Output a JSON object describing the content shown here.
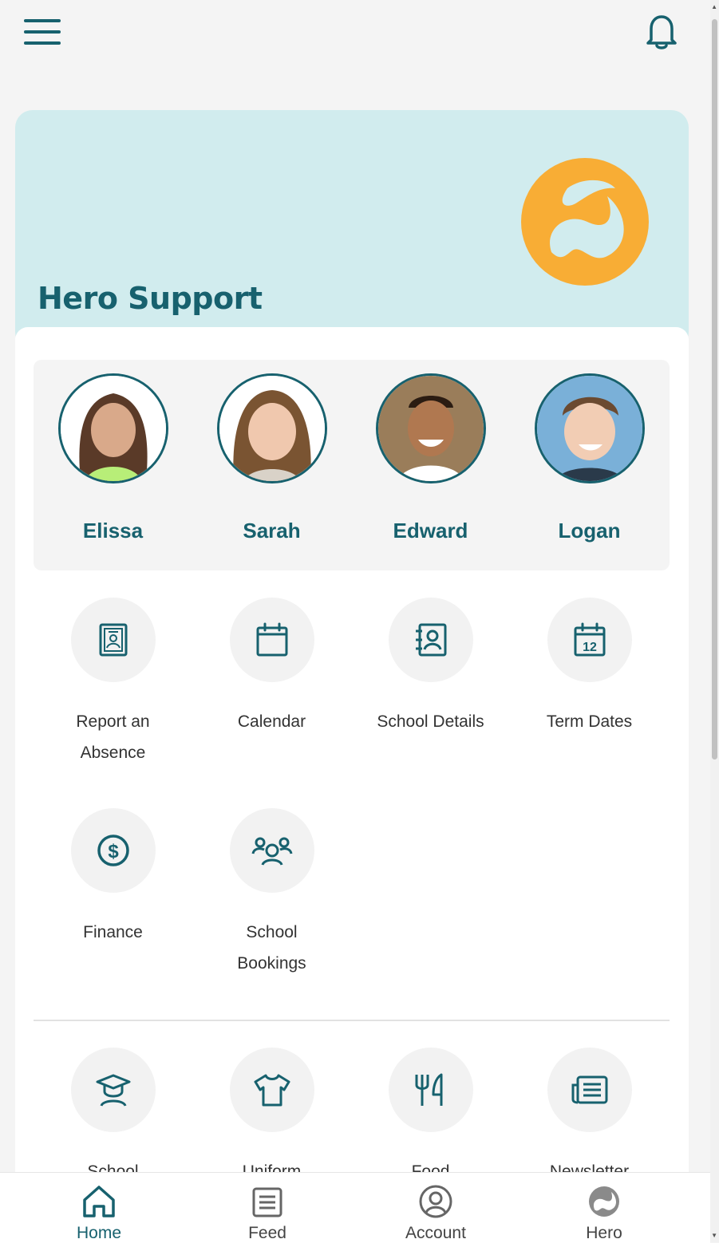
{
  "colors": {
    "brand": "#17616e",
    "hero_bg": "#d1ecee",
    "logo": "#f8ad35",
    "tile_bg": "#f2f2f2"
  },
  "header": {
    "menu_icon": "hamburger-icon",
    "notification_icon": "bell-icon"
  },
  "hero": {
    "title": "Hero Support",
    "logo_icon": "hero-logo-icon"
  },
  "students": [
    {
      "name": "Elissa"
    },
    {
      "name": "Sarah"
    },
    {
      "name": "Edward"
    },
    {
      "name": "Logan"
    }
  ],
  "tiles": [
    {
      "label": "Report an Absence",
      "icon": "absence-badge-icon"
    },
    {
      "label": "Calendar",
      "icon": "calendar-icon"
    },
    {
      "label": "School Details",
      "icon": "contact-book-icon"
    },
    {
      "label": "Term Dates",
      "icon": "calendar-12-icon"
    },
    {
      "label": "Finance",
      "icon": "dollar-icon"
    },
    {
      "label": "School Bookings",
      "icon": "group-icon"
    }
  ],
  "tiles_secondary": [
    {
      "label": "School",
      "icon": "graduate-icon"
    },
    {
      "label": "Uniform",
      "icon": "tshirt-icon"
    },
    {
      "label": "Food",
      "icon": "cutlery-icon"
    },
    {
      "label": "Newsletter",
      "icon": "newspaper-icon"
    }
  ],
  "bottom_nav": [
    {
      "label": "Home",
      "icon": "home-icon",
      "active": true
    },
    {
      "label": "Feed",
      "icon": "feed-icon",
      "active": false
    },
    {
      "label": "Account",
      "icon": "account-icon",
      "active": false
    },
    {
      "label": "Hero",
      "icon": "hero-icon",
      "active": false
    }
  ]
}
